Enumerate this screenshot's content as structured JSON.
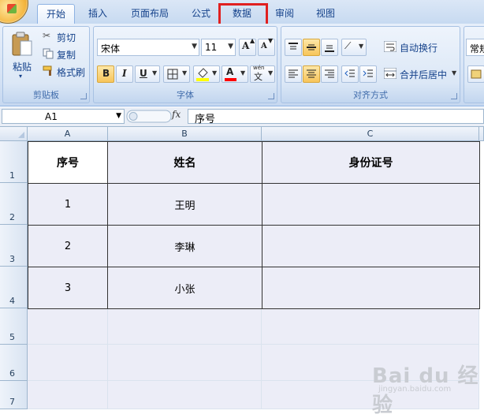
{
  "tabs": [
    {
      "label": "开始",
      "active": true
    },
    {
      "label": "插入"
    },
    {
      "label": "页面布局"
    },
    {
      "label": "公式"
    },
    {
      "label": "数据",
      "highlighted": true
    },
    {
      "label": "审阅"
    },
    {
      "label": "视图"
    }
  ],
  "clipboard": {
    "group_title": "剪贴板",
    "paste": "粘贴",
    "cut": "剪切",
    "copy": "复制",
    "format_painter": "格式刷"
  },
  "font": {
    "group_title": "字体",
    "font_name": "宋体",
    "font_size": "11",
    "bold": "B",
    "italic": "I",
    "underline": "U",
    "grow_font": "A",
    "shrink_font": "A",
    "font_color": "A",
    "phonetic": "文",
    "phonetic_top": "wén"
  },
  "alignment": {
    "group_title": "对齐方式",
    "wrap_text": "自动换行",
    "merge_center": "合并后居中"
  },
  "number": {
    "format_partial": "常规"
  },
  "formula_bar": {
    "name_box": "A1",
    "fx": "fx",
    "content": "序号"
  },
  "columns": [
    "A",
    "B",
    "C"
  ],
  "rows": [
    "1",
    "2",
    "3",
    "4",
    "5",
    "6",
    "7"
  ],
  "table": {
    "headers": [
      "序号",
      "姓名",
      "身份证号"
    ],
    "rows": [
      [
        "1",
        "王明",
        ""
      ],
      [
        "2",
        "李琳",
        ""
      ],
      [
        "3",
        "小张",
        ""
      ]
    ]
  },
  "colors": {
    "highlight_box": "#e02020",
    "font_color_bar": "#ff0000",
    "fill_color_bar": "#ffff00"
  },
  "watermark": {
    "brand": "Bai du 经验",
    "url": "jingyan.baidu.com"
  }
}
